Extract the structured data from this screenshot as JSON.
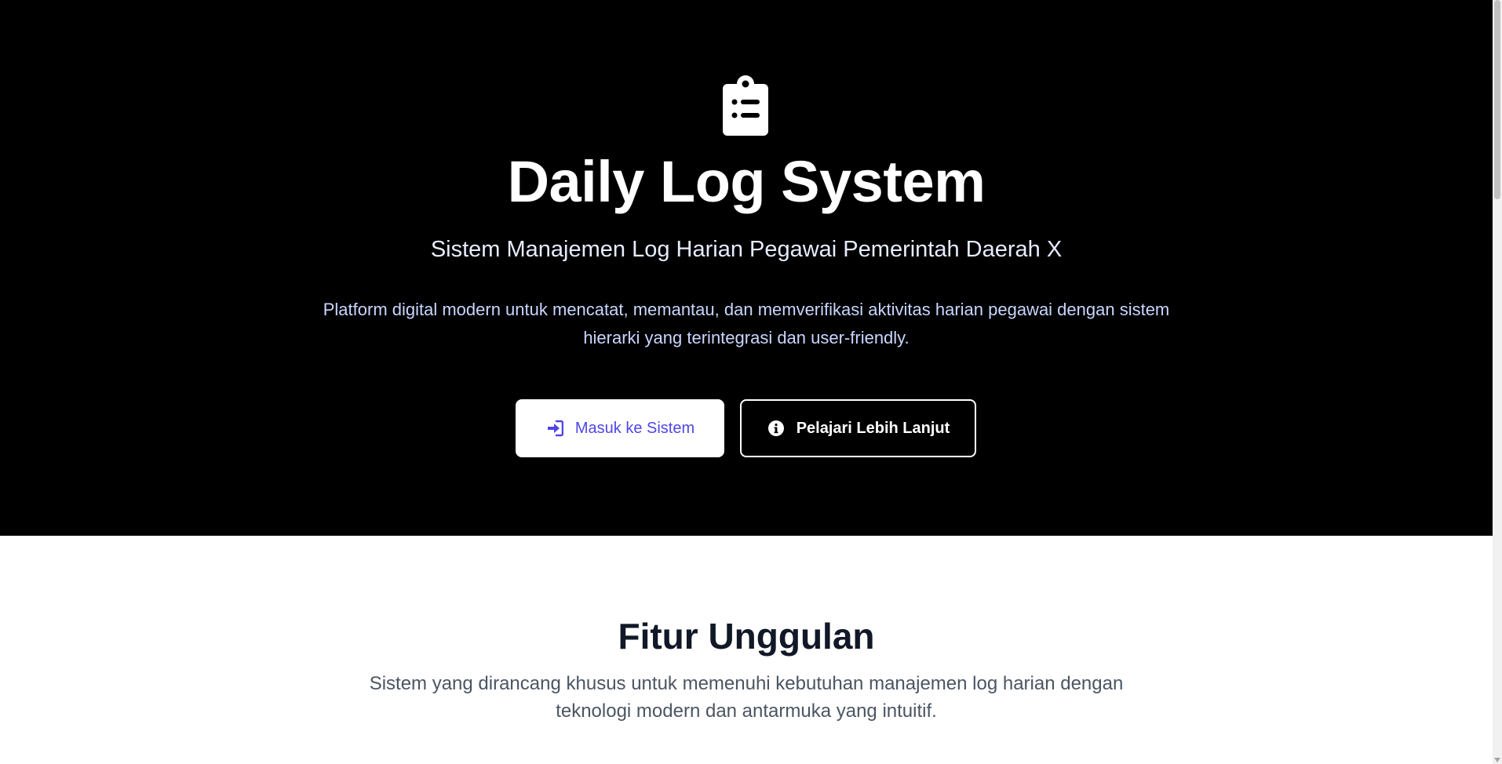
{
  "hero": {
    "icon": "clipboard-list-icon",
    "title": "Daily Log System",
    "subtitle": "Sistem Manajemen Log Harian Pegawai Pemerintah Daerah X",
    "description": "Platform digital modern untuk mencatat, memantau, dan memverifikasi aktivitas harian pegawai dengan sistem hierarki yang terintegrasi dan user-friendly.",
    "primary_button": {
      "label": "Masuk ke Sistem",
      "icon": "sign-in-icon"
    },
    "secondary_button": {
      "label": "Pelajari Lebih Lanjut",
      "icon": "info-circle-icon"
    }
  },
  "features": {
    "title": "Fitur Unggulan",
    "description": "Sistem yang dirancang khusus untuk memenuhi kebutuhan manajemen log harian dengan teknologi modern dan antarmuka yang intuitif."
  },
  "colors": {
    "hero_background": "#000000",
    "accent": "#4f46e5",
    "heading_dark": "#111827",
    "body_gray": "#4b5563"
  }
}
